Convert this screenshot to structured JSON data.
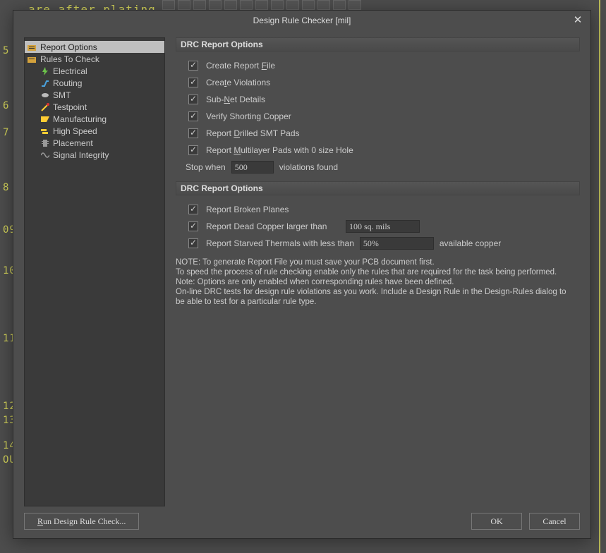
{
  "bg": {
    "editor_text": "are after plating",
    "ruler": [
      "5",
      "6",
      "7",
      "8",
      "09",
      "10",
      "11",
      "12",
      "13",
      "14",
      "OU"
    ]
  },
  "dialog": {
    "title": "Design Rule Checker [mil]"
  },
  "tree": {
    "root1": "Report Options",
    "root2": "Rules To Check",
    "children": [
      "Electrical",
      "Routing",
      "SMT",
      "Testpoint",
      "Manufacturing",
      "High Speed",
      "Placement",
      "Signal Integrity"
    ]
  },
  "section1": {
    "header": "DRC Report Options",
    "cb": {
      "create_report": "Create Report File",
      "create_viol": "Create Violations",
      "subnet": "Sub-Net Details",
      "verify_short": "Verify Shorting Copper",
      "drilled_smt": "Report Drilled SMT Pads",
      "multilayer": "Report Multilayer Pads with 0 size Hole"
    },
    "stop_when_label": "Stop when",
    "stop_when_value": "500",
    "violations_found": "violations found"
  },
  "section2": {
    "header": "DRC Report Options",
    "broken_planes": "Report Broken Planes",
    "dead_copper": "Report Dead Copper larger than",
    "dead_copper_val": "100 sq. mils",
    "starved": "Report Starved Thermals with less than",
    "starved_val": "50%",
    "avail_copper": "available copper"
  },
  "note": {
    "l1": "NOTE: To generate Report File you must save your PCB document first.",
    "l2": "To speed the process of rule checking enable only the rules that are required for the task being performed.  Note: Options are only enabled when corresponding rules have been defined.",
    "l3": "On-line DRC tests for design rule violations as you work. Include a Design Rule in the Design-Rules dialog to be able to test for a particular rule  type."
  },
  "footer": {
    "run": "Run Design Rule Check...",
    "ok": "OK",
    "cancel": "Cancel"
  }
}
